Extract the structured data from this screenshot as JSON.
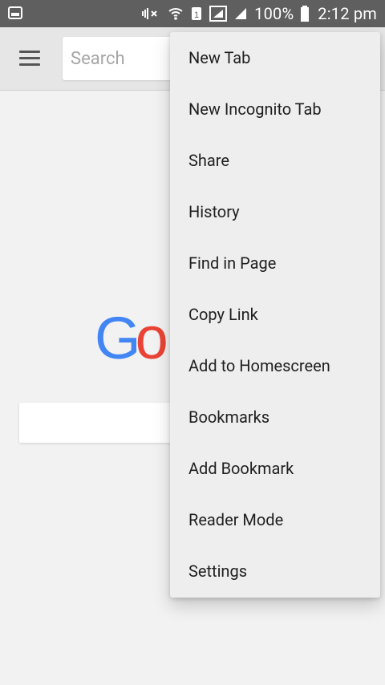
{
  "status_bar": {
    "battery_percent": "100%",
    "time": "2:12 pm",
    "icons": [
      "image-notification-icon",
      "mute-vibrate-icon",
      "wifi-icon",
      "sim-icon",
      "signal-icon",
      "signal-icon",
      "battery-icon"
    ]
  },
  "toolbar": {
    "search": {
      "placeholder": "Search",
      "value": ""
    },
    "menu_icon": "hamburger-icon"
  },
  "page": {
    "logo_partial": {
      "g": "G",
      "o": "o"
    }
  },
  "overflow_menu": {
    "items": [
      {
        "label": "New Tab"
      },
      {
        "label": "New Incognito Tab"
      },
      {
        "label": "Share"
      },
      {
        "label": "History"
      },
      {
        "label": "Find in Page"
      },
      {
        "label": "Copy Link"
      },
      {
        "label": "Add to Homescreen"
      },
      {
        "label": "Bookmarks"
      },
      {
        "label": "Add Bookmark"
      },
      {
        "label": "Reader Mode"
      },
      {
        "label": "Settings"
      }
    ]
  },
  "colors": {
    "status_bar_bg": "#5f5f5f",
    "app_bar_bg": "#e6e6e6",
    "page_bg": "#f2f2f2",
    "menu_bg": "#eeeeee",
    "google_blue": "#4285f4",
    "google_red": "#ea4335"
  }
}
